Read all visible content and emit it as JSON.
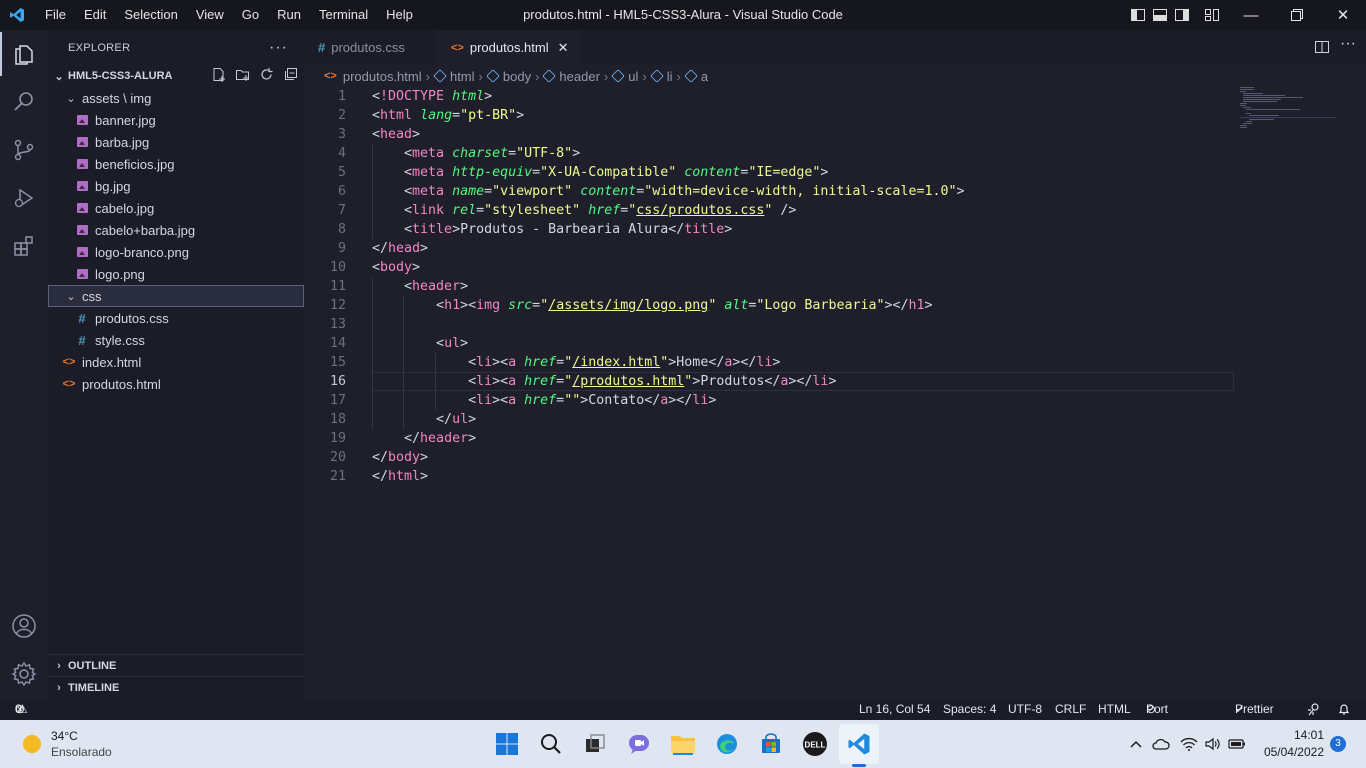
{
  "window": {
    "title": "produtos.html - HML5-CSS3-Alura - Visual Studio Code",
    "menu": [
      "File",
      "Edit",
      "Selection",
      "View",
      "Go",
      "Run",
      "Terminal",
      "Help"
    ]
  },
  "sidebar": {
    "header": "EXPLORER",
    "more": "···",
    "project": "HML5-CSS3-ALURA",
    "tree": [
      {
        "label": "assets \\ img",
        "kind": "folder"
      },
      {
        "label": "banner.jpg",
        "kind": "image"
      },
      {
        "label": "barba.jpg",
        "kind": "image"
      },
      {
        "label": "beneficios.jpg",
        "kind": "image"
      },
      {
        "label": "bg.jpg",
        "kind": "image"
      },
      {
        "label": "cabelo.jpg",
        "kind": "image"
      },
      {
        "label": "cabelo+barba.jpg",
        "kind": "image"
      },
      {
        "label": "logo-branco.png",
        "kind": "image"
      },
      {
        "label": "logo.png",
        "kind": "image"
      },
      {
        "label": "css",
        "kind": "folder"
      },
      {
        "label": "produtos.css",
        "kind": "css"
      },
      {
        "label": "style.css",
        "kind": "css"
      },
      {
        "label": "index.html",
        "kind": "html"
      },
      {
        "label": "produtos.html",
        "kind": "html"
      }
    ],
    "outline": "OUTLINE",
    "timeline": "TIMELINE"
  },
  "tabs": [
    {
      "label": "produtos.css",
      "active": false
    },
    {
      "label": "produtos.html",
      "active": true
    }
  ],
  "breadcrumb": [
    "produtos.html",
    "html",
    "body",
    "header",
    "ul",
    "li",
    "a"
  ],
  "editor": {
    "current_line": 16,
    "line_numbers": [
      "1",
      "2",
      "3",
      "4",
      "5",
      "6",
      "7",
      "8",
      "9",
      "10",
      "11",
      "12",
      "13",
      "14",
      "15",
      "16",
      "17",
      "18",
      "19",
      "20",
      "21"
    ],
    "text": {
      "doctype": "!DOCTYPE",
      "html": "html",
      "lang": "lang",
      "lang_val": "\"pt-BR\"",
      "head": "head",
      "meta": "meta",
      "charset": "charset",
      "charset_val": "\"UTF-8\"",
      "http_equiv": "http-equiv",
      "http_equiv_val": "\"X-UA-Compatible\"",
      "content": "content",
      "content_val1": "\"IE=edge\"",
      "name": "name",
      "name_val": "\"viewport\"",
      "content_val2": "\"width=device-width, initial-scale=1.0\"",
      "link": "link",
      "rel": "rel",
      "rel_val": "\"stylesheet\"",
      "href": "href",
      "href_css": "css/produtos.css",
      "title": "title",
      "title_text": "Produtos - Barbearia Alura",
      "body": "body",
      "header": "header",
      "h1": "h1",
      "img": "img",
      "src": "src",
      "src_val": "/assets/img/logo.png",
      "alt": "alt",
      "alt_val": "\"Logo Barbearia\"",
      "ul": "ul",
      "li": "li",
      "a": "a",
      "href_index": "/index.html",
      "home": "Home",
      "href_produtos": "/produtos.html",
      "produtos": "Produtos",
      "empty_href": "\"\"",
      "contato": "Contato"
    }
  },
  "statusbar": {
    "errors": "0",
    "warnings": "0",
    "position": "Ln 16, Col 54",
    "spaces": "Spaces: 4",
    "encoding": "UTF-8",
    "eol": "CRLF",
    "language": "HTML",
    "port": "Port : 5500",
    "prettier": "Prettier"
  },
  "taskbar": {
    "temperature": "34°C",
    "weather": "Ensolarado",
    "time": "14:01",
    "date": "05/04/2022",
    "notifications": "3"
  },
  "colors": {
    "editor_bg": "#1e1f2b",
    "sidebar_bg": "#1b1c27",
    "tag": "#f286c4",
    "attr": "#50fa7b",
    "string": "#f1fa8c"
  }
}
